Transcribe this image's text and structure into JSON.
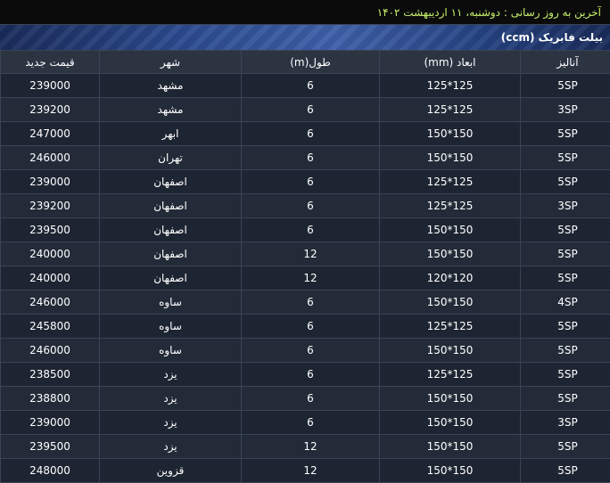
{
  "header": {
    "last_update": "آخرین به روز رسانی : دوشنبه، ۱۱ اردیبهشت ۱۴۰۲"
  },
  "table": {
    "title": "بیلت فابریک (ccm)",
    "columns": {
      "price": "قیمت جدید",
      "city": "شهر",
      "length": "طول(m)",
      "dimension": "ابعاد (mm)",
      "grade": "آنالیز"
    },
    "rows": [
      {
        "price": "239000",
        "city": "مشهد",
        "length": "6",
        "dimension": "125*125",
        "grade": "5SP"
      },
      {
        "price": "239200",
        "city": "مشهد",
        "length": "6",
        "dimension": "125*125",
        "grade": "3SP"
      },
      {
        "price": "247000",
        "city": "ابهر",
        "length": "6",
        "dimension": "150*150",
        "grade": "5SP"
      },
      {
        "price": "246000",
        "city": "تهران",
        "length": "6",
        "dimension": "150*150",
        "grade": "5SP"
      },
      {
        "price": "239000",
        "city": "اصفهان",
        "length": "6",
        "dimension": "125*125",
        "grade": "5SP"
      },
      {
        "price": "239200",
        "city": "اصفهان",
        "length": "6",
        "dimension": "125*125",
        "grade": "3SP"
      },
      {
        "price": "239500",
        "city": "اصفهان",
        "length": "6",
        "dimension": "150*150",
        "grade": "5SP"
      },
      {
        "price": "240000",
        "city": "اصفهان",
        "length": "12",
        "dimension": "150*150",
        "grade": "5SP"
      },
      {
        "price": "240000",
        "city": "اصفهان",
        "length": "12",
        "dimension": "120*120",
        "grade": "5SP"
      },
      {
        "price": "246000",
        "city": "ساوه",
        "length": "6",
        "dimension": "150*150",
        "grade": "4SP"
      },
      {
        "price": "245800",
        "city": "ساوه",
        "length": "6",
        "dimension": "125*125",
        "grade": "5SP"
      },
      {
        "price": "246000",
        "city": "ساوه",
        "length": "6",
        "dimension": "150*150",
        "grade": "5SP"
      },
      {
        "price": "238500",
        "city": "یزد",
        "length": "6",
        "dimension": "125*125",
        "grade": "5SP"
      },
      {
        "price": "238800",
        "city": "یزد",
        "length": "6",
        "dimension": "150*150",
        "grade": "5SP"
      },
      {
        "price": "239000",
        "city": "یزد",
        "length": "6",
        "dimension": "150*150",
        "grade": "3SP"
      },
      {
        "price": "239500",
        "city": "یزد",
        "length": "12",
        "dimension": "150*150",
        "grade": "5SP"
      },
      {
        "price": "248000",
        "city": "قزوین",
        "length": "12",
        "dimension": "150*150",
        "grade": "5SP"
      }
    ]
  }
}
